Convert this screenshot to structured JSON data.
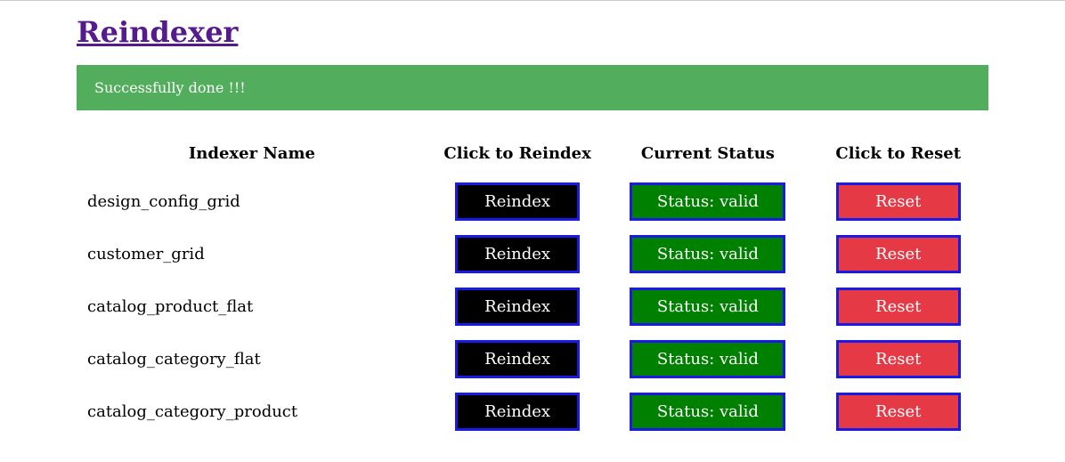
{
  "header": {
    "title": "Reindexer"
  },
  "alert": {
    "message": "Successfully done !!!"
  },
  "table": {
    "columns": {
      "name": "Indexer Name",
      "reindex": "Click to Reindex",
      "status": "Current Status",
      "reset": "Click to Reset"
    },
    "reindex_label": "Reindex",
    "reset_label": "Reset",
    "status_prefix": "Status: ",
    "rows": [
      {
        "name": "design_config_grid",
        "status": "valid"
      },
      {
        "name": "customer_grid",
        "status": "valid"
      },
      {
        "name": "catalog_product_flat",
        "status": "valid"
      },
      {
        "name": "catalog_category_flat",
        "status": "valid"
      },
      {
        "name": "catalog_category_product",
        "status": "valid"
      }
    ]
  }
}
